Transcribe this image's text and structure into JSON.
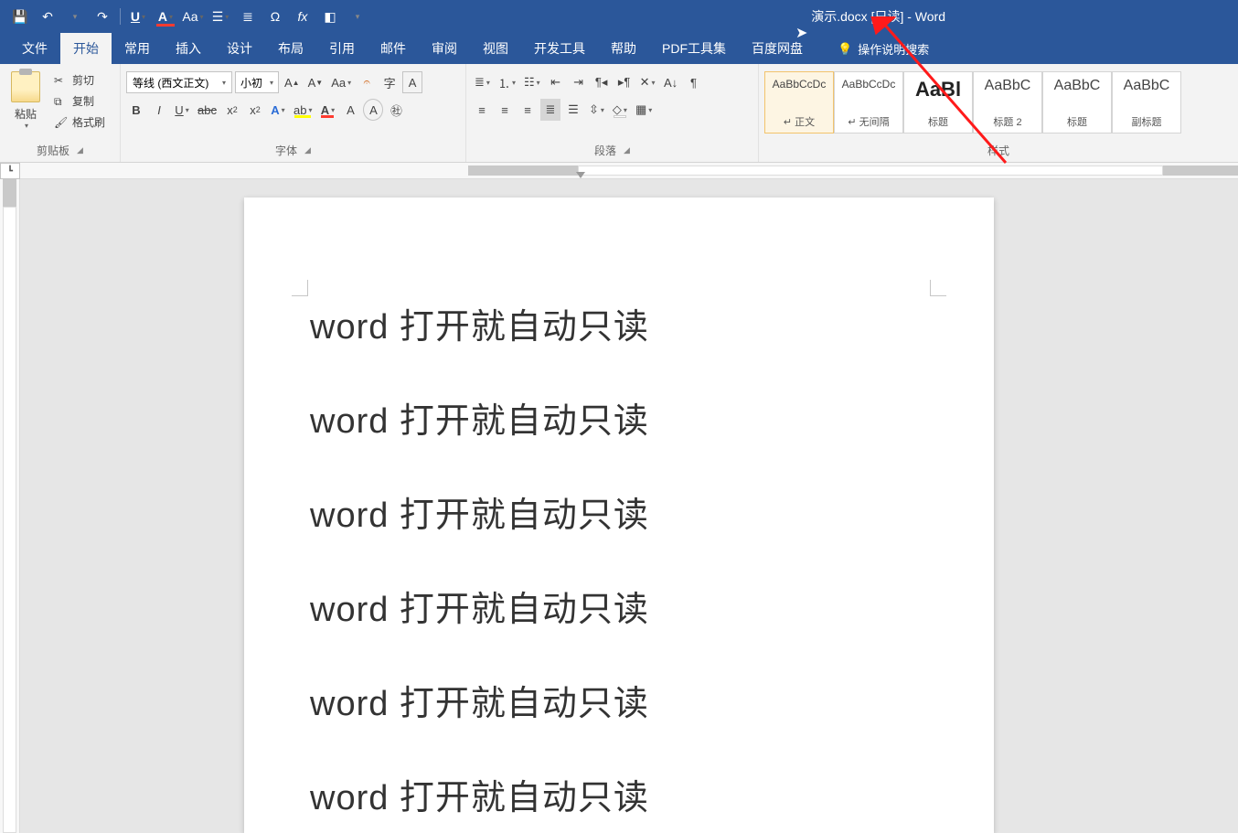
{
  "titlebar": {
    "title": "演示.docx [只读]  -  Word"
  },
  "tabs": {
    "file": "文件",
    "home": "开始",
    "common": "常用",
    "insert": "插入",
    "design": "设计",
    "layout": "布局",
    "references": "引用",
    "mailings": "邮件",
    "review": "审阅",
    "view": "视图",
    "developer": "开发工具",
    "help": "帮助",
    "pdf": "PDF工具集",
    "baidu": "百度网盘",
    "tellme": "操作说明搜索"
  },
  "groups": {
    "clipboard": "剪贴板",
    "font": "字体",
    "paragraph": "段落",
    "styles": "样式"
  },
  "clipboard": {
    "paste": "粘贴",
    "cut": "剪切",
    "copy": "复制",
    "format_painter": "格式刷"
  },
  "font": {
    "name": "等线 (西文正文)",
    "size": "小初"
  },
  "styles": [
    {
      "preview": "AaBbCcDc",
      "name": "↵ 正文",
      "cls": ""
    },
    {
      "preview": "AaBbCcDc",
      "name": "↵ 无间隔",
      "cls": ""
    },
    {
      "preview": "AaBl",
      "name": "标题",
      "cls": "big"
    },
    {
      "preview": "AaBbC",
      "name": "标题 2",
      "cls": "mid"
    },
    {
      "preview": "AaBbC",
      "name": "标题",
      "cls": "mid"
    },
    {
      "preview": "AaBbC",
      "name": "副标题",
      "cls": "mid"
    }
  ],
  "document": {
    "lines": [
      "word 打开就自动只读",
      "word 打开就自动只读",
      "word 打开就自动只读",
      "word 打开就自动只读",
      "word 打开就自动只读",
      "word 打开就自动只读"
    ]
  },
  "colors": {
    "accent": "#2b579a",
    "arrow": "#ff1a1a"
  }
}
